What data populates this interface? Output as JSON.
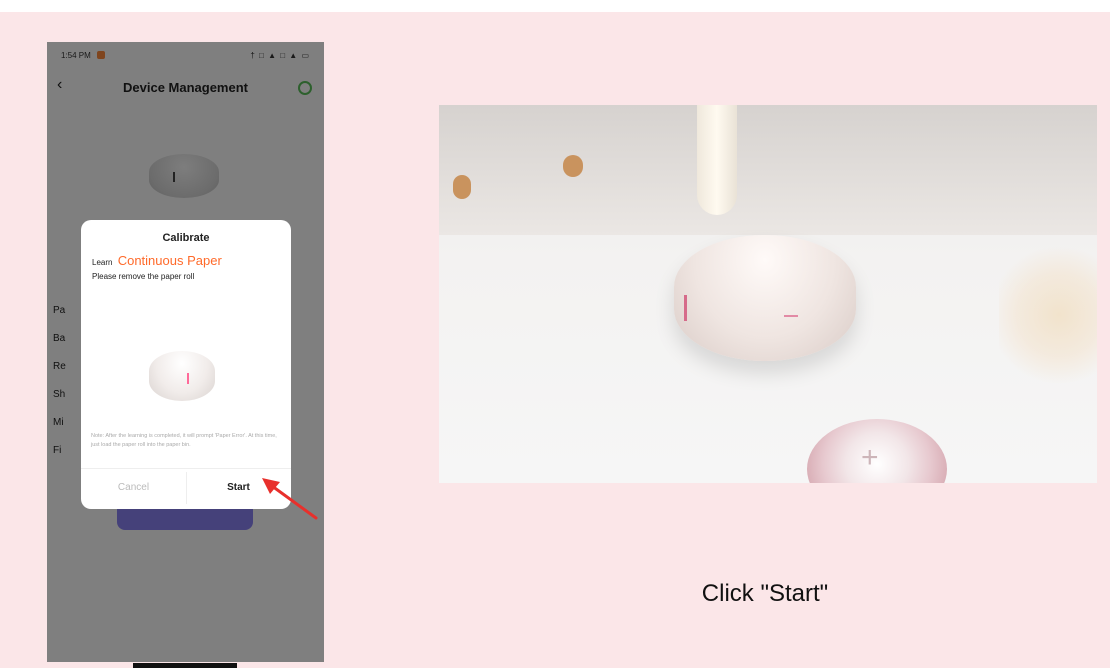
{
  "phone": {
    "status_time": "1:54 PM",
    "status_icons": "† □ ▲ □ ▲ ▭",
    "nav_back": "‹",
    "nav_title": "Device Management",
    "info_rows": [
      "Pa",
      "Ba",
      "Re",
      "Sh",
      "Mi",
      "Fi"
    ],
    "dialog": {
      "title": "Calibrate",
      "learn_prefix": "Learn",
      "learn_accent": "Continuous Paper",
      "instruction": "Please remove the paper roll",
      "note": "Note: After the learning is completed, it will prompt 'Paper Error'. At this time, just load the paper roll into the paper bin.",
      "cancel_label": "Cancel",
      "start_label": "Start"
    }
  },
  "caption": "Click \"Start\"",
  "colors": {
    "slide_bg": "#fbe6e8",
    "accent_orange": "#ff6a2a",
    "arrow_red": "#e8302c",
    "button_purple": "#8a82f5"
  },
  "icons": [
    "back-arrow-icon",
    "record-indicator-icon",
    "status-icons",
    "settings-ring-icon",
    "red-arrow-icon"
  ]
}
